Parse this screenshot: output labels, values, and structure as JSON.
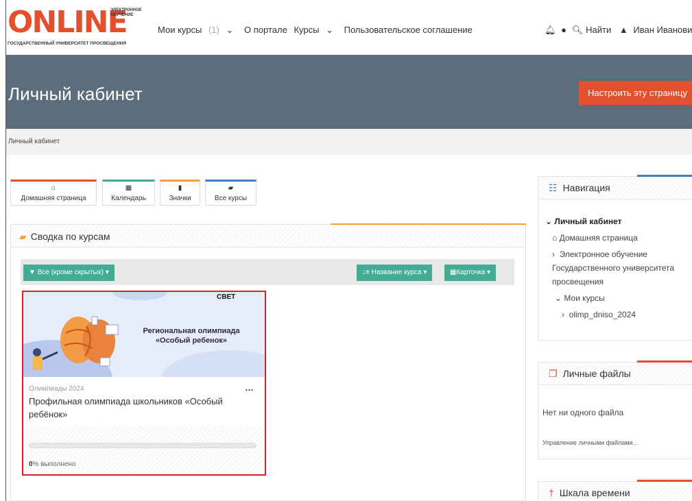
{
  "logo": {
    "main": "ONLINE",
    "side": "ЭЛЕКТРОННОЕ ОБУЧЕНИЕ",
    "sub": "ГОСУДАРСТВЕННЫЙ УНИВЕРСИТЕТ ПРОСВЕЩЕНИЯ"
  },
  "topnav": {
    "my_courses": "Мои курсы",
    "my_courses_count": "(1)",
    "about": "О портале",
    "courses": "Курсы",
    "agreement": "Пользовательское соглашение",
    "search": "Найти",
    "user": "Иван Иванови"
  },
  "header": {
    "title": "Личный кабинет",
    "customize": "Настроить эту страницу"
  },
  "breadcrumb": "Личный кабинет",
  "quick_links": [
    {
      "label": "Домашняя страница",
      "color": "#e4502d"
    },
    {
      "label": "Календарь",
      "color": "#45ab95"
    },
    {
      "label": "Значки",
      "color": "#f3a33b"
    },
    {
      "label": "Все курсы",
      "color": "#3f7fbf"
    }
  ],
  "overview": {
    "title": "Сводка по курсам",
    "filter": "Все (кроме скрытых)",
    "sort": "Название курса",
    "view": "Карточка",
    "card": {
      "image_title": "Региональная олимпиада «Особый ребенок»",
      "brand": "СВЕТ",
      "category": "Олимпиады 2024",
      "name": "Профильная олимпиада школьников «Особый ребёнок»",
      "progress_value": "0",
      "progress_suffix": "% выполнено",
      "progress": 0
    }
  },
  "navigation": {
    "title": "Навигация",
    "items": {
      "dashboard": "Личный кабинет",
      "home": "Домашняя страница",
      "elearning_1": "Электронное обучение",
      "elearning_2": "Государственного университета",
      "elearning_3": "просвещения",
      "my_courses": "Мои курсы",
      "course": "olimp_dniso_2024"
    }
  },
  "private_files": {
    "title": "Личные файлы",
    "empty": "Нет ни одного файла",
    "manage": "Управление личными файлами..."
  },
  "timeline": {
    "title": "Шкала времени"
  },
  "colors": {
    "accent_orange": "#e4502d",
    "teal": "#45ab95",
    "header_bg": "#5c6e7c",
    "highlight_red": "#e01b24"
  }
}
